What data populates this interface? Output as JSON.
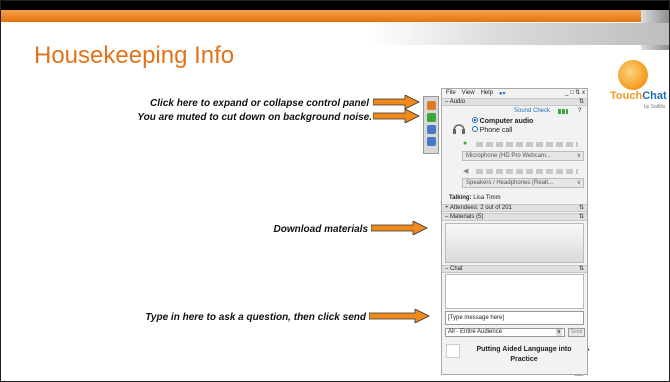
{
  "slide": {
    "title": "Housekeeping Info"
  },
  "logo": {
    "brand_part1": "Touch",
    "brand_part2": "Chat",
    "sub": "by Saltillo"
  },
  "callouts": {
    "expand": "Click here to expand or collapse control panel",
    "muted": "You are muted to cut down on background noise.",
    "download": "Download materials",
    "question": "Type in here to ask a question, then click send"
  },
  "panel": {
    "menu": [
      "File",
      "View",
      "Help"
    ],
    "window_buttons": "_ □ ⇅ x",
    "audio": {
      "header": "Audio",
      "sound_check": "Sound Check",
      "help": "?",
      "option_computer": "Computer audio",
      "option_phone": "Phone call",
      "microphone": "Microphone (HD Pro Webcam...",
      "speakers": "Speakers / Headphones (Realt...",
      "talking_label": "Talking:",
      "talking_name": "Lisa Timm"
    },
    "attendees": "Attendees:  2 out of 201",
    "materials": "Materials (5)",
    "chat": {
      "header": "Chat",
      "placeholder": "[Type message here]",
      "audience": "All - Entire Audience",
      "send": "Send"
    },
    "footer_title": "Putting Aided Language into Practice"
  },
  "colors": {
    "title": "#e2731a",
    "arrow": "#f08a1c",
    "band": "#e4730e",
    "link": "#1e6fb5"
  }
}
